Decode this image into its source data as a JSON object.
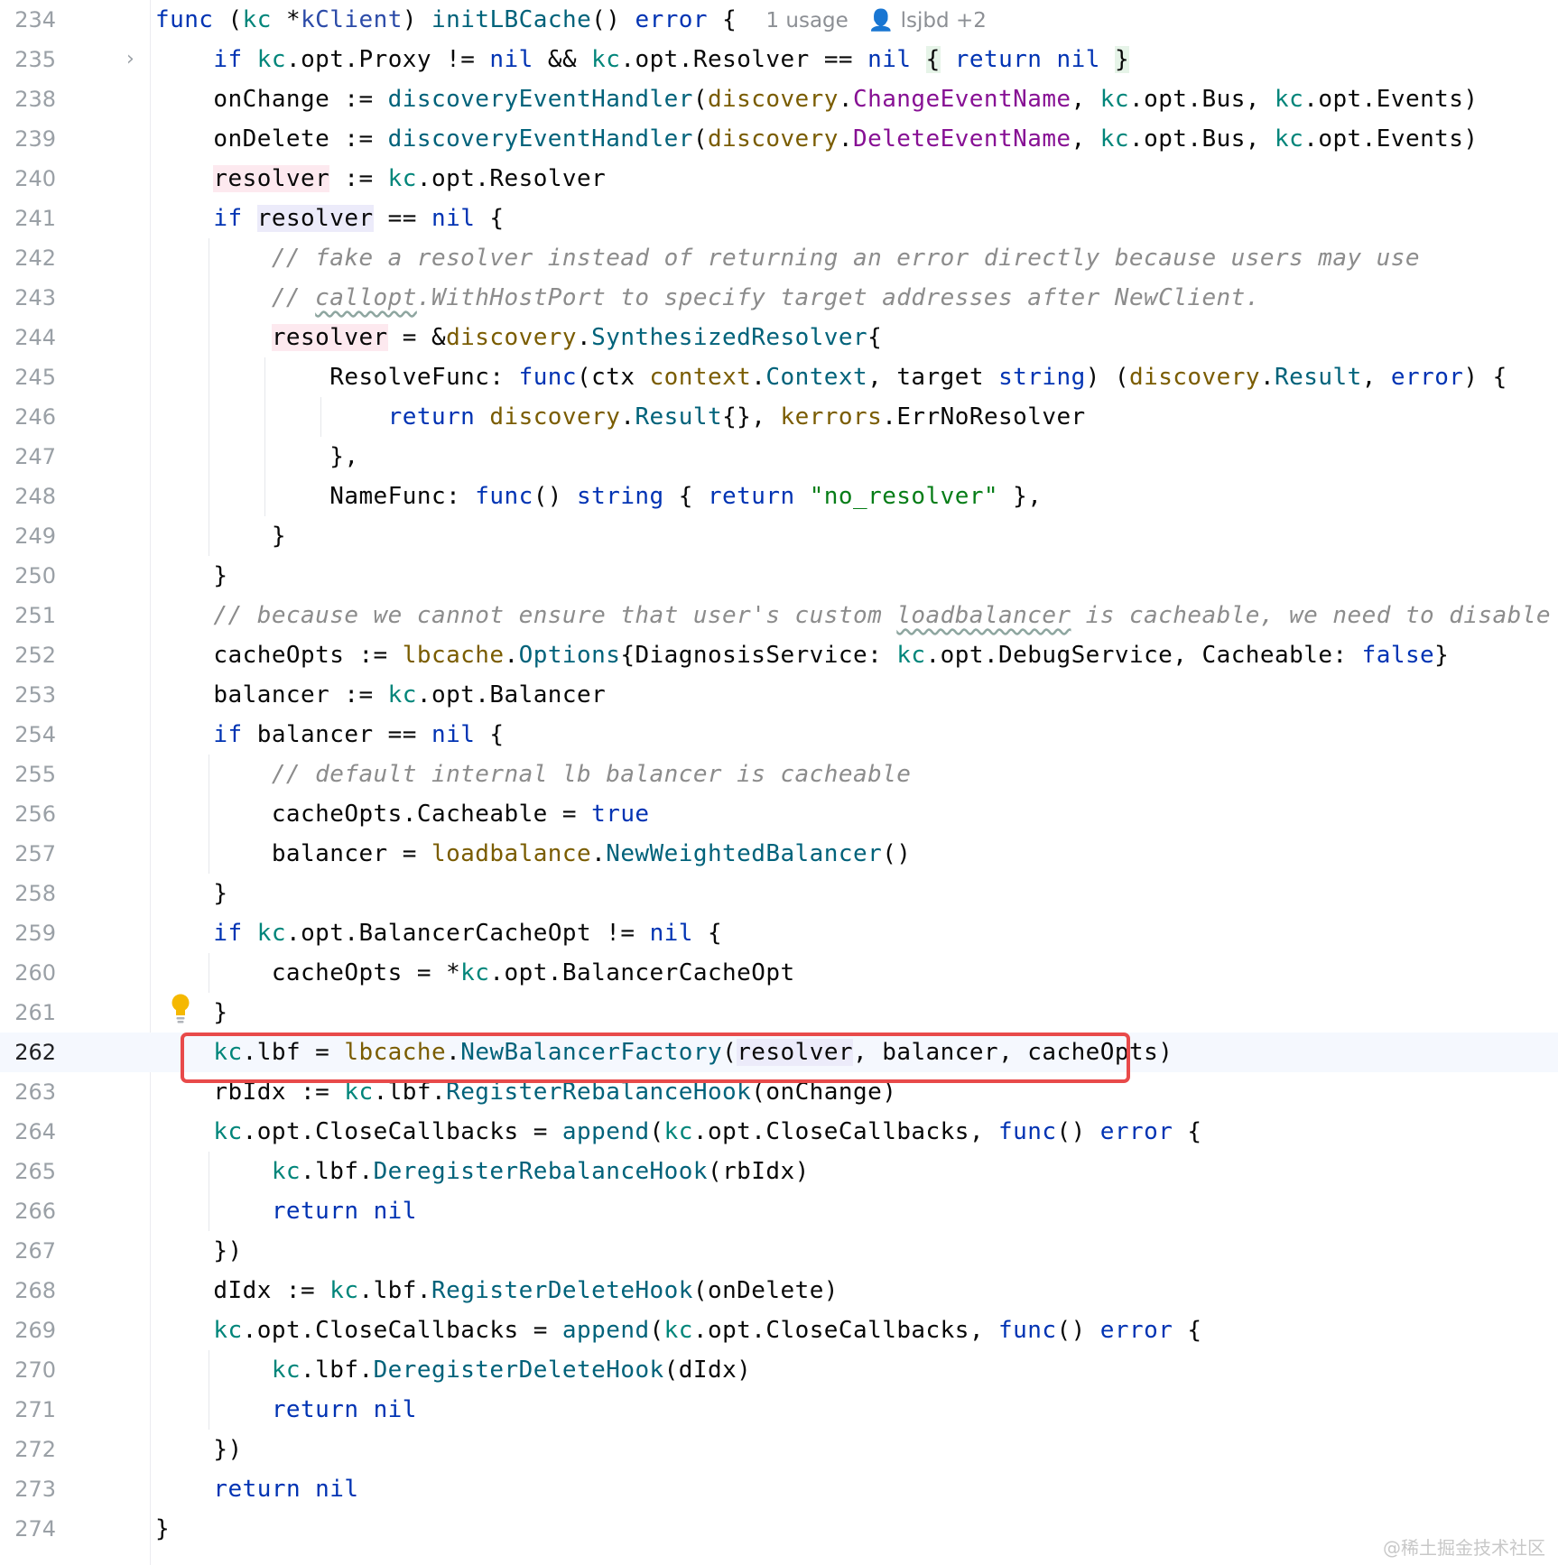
{
  "lines": [
    {
      "n": "234",
      "html": "<span class=\"kw\">func</span> (<span class=\"var\">kc</span> *<span class=\"ty2\">kClient</span>) <span class=\"fn\">initLBCache</span>() <span class=\"kw\">error</span> {  <span class=\"inlay\">1 usage   &#x1F464; lsjbd +2</span>"
    },
    {
      "n": "235",
      "html": "    <span class=\"kw\">if</span> <span class=\"var\">kc</span>.opt.Proxy != <span class=\"kw\">nil</span> &amp;&amp; <span class=\"var\">kc</span>.opt.Resolver == <span class=\"kw\">nil</span> <span class=\"hl-green\">{</span> <span class=\"kw\">return</span> <span class=\"kw\">nil</span> <span class=\"hl-green\">}</span>"
    },
    {
      "n": "238",
      "html": "    onChange := <span class=\"fn\">discoveryEventHandler</span>(<span class=\"pkg\">discovery</span>.<span class=\"const\">ChangeEventName</span>, <span class=\"var\">kc</span>.opt.Bus, <span class=\"var\">kc</span>.opt.Events)"
    },
    {
      "n": "239",
      "html": "    onDelete := <span class=\"fn\">discoveryEventHandler</span>(<span class=\"pkg\">discovery</span>.<span class=\"const\">DeleteEventName</span>, <span class=\"var\">kc</span>.opt.Bus, <span class=\"var\">kc</span>.opt.Events)"
    },
    {
      "n": "240",
      "html": "    <span class=\"hl-pink\">resolver</span> := <span class=\"var\">kc</span>.opt.Resolver"
    },
    {
      "n": "241",
      "html": "    <span class=\"kw\">if</span> <span class=\"hl-lav\">resolver</span> == <span class=\"kw\">nil</span> {"
    },
    {
      "n": "242",
      "html": "        <span class=\"com\">// fake a resolver instead of returning an error directly because users may use</span>"
    },
    {
      "n": "243",
      "html": "        <span class=\"com\">// <span class=\"typo\">callopt</span>.WithHostPort to specify target addresses after NewClient.</span>"
    },
    {
      "n": "244",
      "html": "        <span class=\"hl-pink\">resolver</span> = &amp;<span class=\"pkg\">discovery</span>.<span class=\"typ\">SynthesizedResolver</span>{"
    },
    {
      "n": "245",
      "html": "            ResolveFunc: <span class=\"kw\">func</span>(ctx <span class=\"pkg\">context</span>.<span class=\"typ\">Context</span>, target <span class=\"kw\">string</span>) (<span class=\"pkg\">discovery</span>.<span class=\"typ\">Result</span>, <span class=\"kw\">error</span>) {"
    },
    {
      "n": "246",
      "html": "                <span class=\"kw\">return</span> <span class=\"pkg\">discovery</span>.<span class=\"typ\">Result</span>{}, <span class=\"pkg\">kerrors</span>.ErrNoResolver"
    },
    {
      "n": "247",
      "html": "            },"
    },
    {
      "n": "248",
      "html": "            NameFunc: <span class=\"kw\">func</span>() <span class=\"kw\">string</span> { <span class=\"kw\">return</span> <span class=\"str\">\"no_resolver\"</span> },"
    },
    {
      "n": "249",
      "html": "        }"
    },
    {
      "n": "250",
      "html": "    }"
    },
    {
      "n": "251",
      "html": "    <span class=\"com\">// because we cannot ensure that user's custom <span class=\"typo\">loadbalancer</span> is cacheable, we need to disable it</span>"
    },
    {
      "n": "252",
      "html": "    cacheOpts := <span class=\"pkg\">lbcache</span>.<span class=\"typ\">Options</span>{DiagnosisService: <span class=\"var\">kc</span>.opt.DebugService, Cacheable: <span class=\"kw\">false</span>}"
    },
    {
      "n": "253",
      "html": "    balancer := <span class=\"var\">kc</span>.opt.Balancer"
    },
    {
      "n": "254",
      "html": "    <span class=\"kw\">if</span> balancer == <span class=\"kw\">nil</span> {"
    },
    {
      "n": "255",
      "html": "        <span class=\"com\">// default internal lb balancer is cacheable</span>"
    },
    {
      "n": "256",
      "html": "        cacheOpts.Cacheable = <span class=\"kw\">true</span>"
    },
    {
      "n": "257",
      "html": "        balancer = <span class=\"pkg\">loadbalance</span>.<span class=\"fn\">NewWeightedBalancer</span>()"
    },
    {
      "n": "258",
      "html": "    }"
    },
    {
      "n": "259",
      "html": "    <span class=\"kw\">if</span> <span class=\"var\">kc</span>.opt.BalancerCacheOpt != <span class=\"kw\">nil</span> {"
    },
    {
      "n": "260",
      "html": "        cacheOpts = *<span class=\"var\">kc</span>.opt.BalancerCacheOpt"
    },
    {
      "n": "261",
      "html": "    }"
    },
    {
      "n": "262",
      "html": "    <span class=\"var\">kc</span>.lbf = <span class=\"pkg\">lbcache</span>.<span class=\"fn\">NewBalancerFactory</span>(<span class=\"hl-lav\">resolver</span>, balancer, cacheOpts)"
    },
    {
      "n": "263",
      "html": "    rbIdx := <span class=\"var\">kc</span>.lbf.<span class=\"fn\">RegisterRebalanceHook</span>(onChange)"
    },
    {
      "n": "264",
      "html": "    <span class=\"var\">kc</span>.opt.CloseCallbacks = <span class=\"fn\">append</span>(<span class=\"var\">kc</span>.opt.CloseCallbacks, <span class=\"kw\">func</span>() <span class=\"kw\">error</span> {"
    },
    {
      "n": "265",
      "html": "        <span class=\"var\">kc</span>.lbf.<span class=\"fn\">DeregisterRebalanceHook</span>(rbIdx)"
    },
    {
      "n": "266",
      "html": "        <span class=\"kw\">return</span> <span class=\"kw\">nil</span>"
    },
    {
      "n": "267",
      "html": "    })"
    },
    {
      "n": "268",
      "html": "    dIdx := <span class=\"var\">kc</span>.lbf.<span class=\"fn\">RegisterDeleteHook</span>(onDelete)"
    },
    {
      "n": "269",
      "html": "    <span class=\"var\">kc</span>.opt.CloseCallbacks = <span class=\"fn\">append</span>(<span class=\"var\">kc</span>.opt.CloseCallbacks, <span class=\"kw\">func</span>() <span class=\"kw\">error</span> {"
    },
    {
      "n": "270",
      "html": "        <span class=\"var\">kc</span>.lbf.<span class=\"fn\">DeregisterDeleteHook</span>(dIdx)"
    },
    {
      "n": "271",
      "html": "        <span class=\"kw\">return</span> <span class=\"kw\">nil</span>"
    },
    {
      "n": "272",
      "html": "    })"
    },
    {
      "n": "273",
      "html": "    <span class=\"kw\">return</span> <span class=\"kw\">nil</span>"
    },
    {
      "n": "274",
      "html": "}"
    }
  ],
  "current_line": "262",
  "watermark": "@稀土掘金技术社区",
  "colors": {
    "keyword": "#0033b3",
    "receiver": "#00857a",
    "function": "#00627a",
    "package": "#7a5c00",
    "constant": "#871094",
    "string": "#067d17",
    "comment": "#8c8c8c",
    "highlight_box": "#e84a4a"
  },
  "icons": {
    "fold": "chevron-right-icon",
    "intention": "lightbulb-icon"
  }
}
